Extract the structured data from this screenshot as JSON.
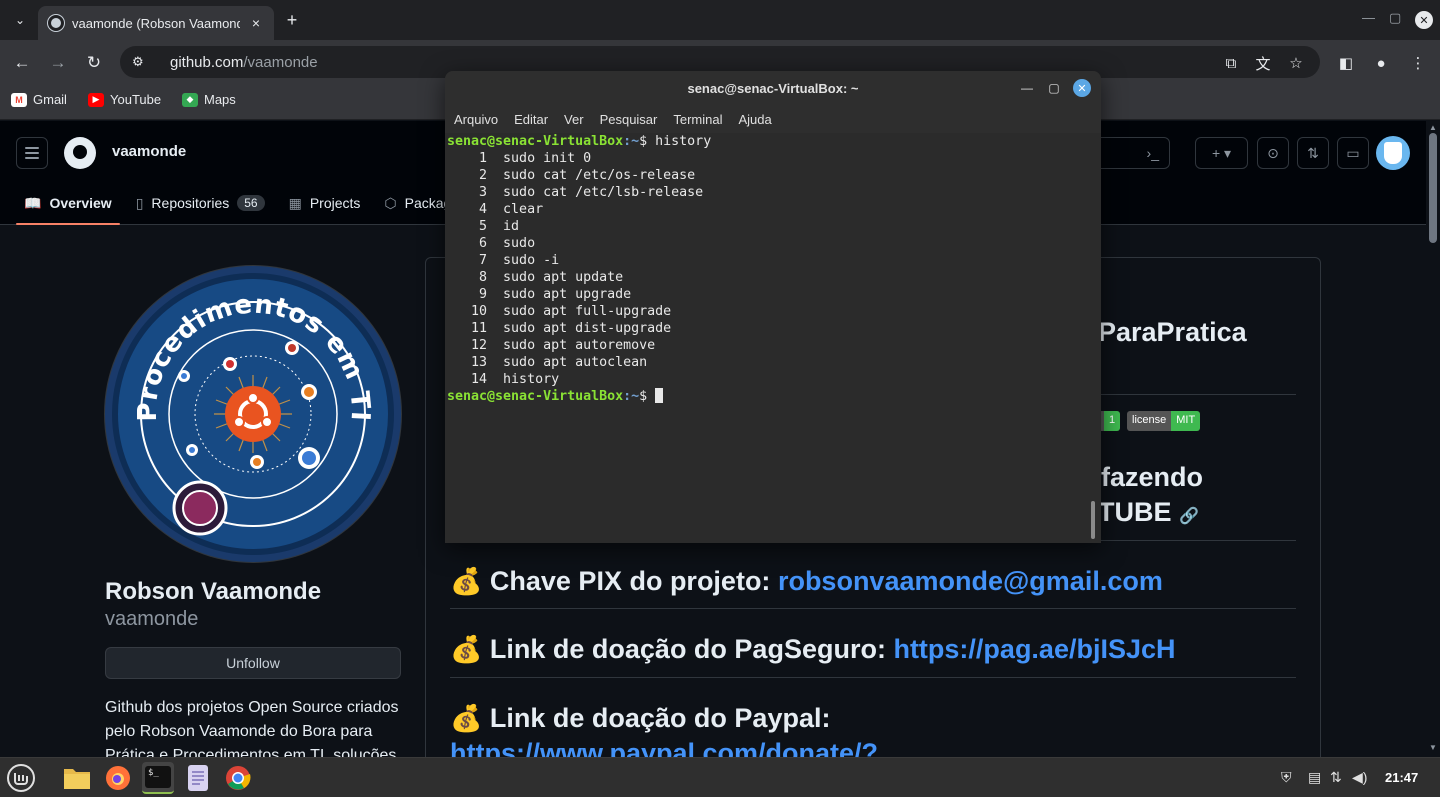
{
  "browser": {
    "tab": {
      "title": "vaamonde (Robson Vaamonde)",
      "close": "×"
    },
    "new_tab": "+",
    "url": {
      "host": "github.com",
      "path": "/vaamonde"
    },
    "bookmarks": [
      {
        "label": "Gmail",
        "icon": "gmail-icon",
        "color": "#ea4335"
      },
      {
        "label": "YouTube",
        "icon": "youtube-icon",
        "color": "#ff0000"
      },
      {
        "label": "Maps",
        "icon": "maps-icon",
        "color": "#34a853"
      }
    ]
  },
  "github": {
    "username": "vaamonde",
    "tabs": [
      {
        "label": "Overview",
        "icon": "book-icon"
      },
      {
        "label": "Repositories",
        "icon": "repo-icon",
        "count": "56"
      },
      {
        "label": "Projects",
        "icon": "table-icon"
      },
      {
        "label": "Packages",
        "icon": "package-icon"
      }
    ],
    "profile": {
      "name": "Robson Vaamonde",
      "login": "vaamonde",
      "follow_button": "Unfollow",
      "bio": "Github dos projetos Open Source criados pelo Robson Vaamonde do Bora para Prática e Procedimentos em TI, soluções"
    },
    "avatar_text": "Procedimentos em TI",
    "readme": {
      "heading1_tail": "ParaPratica",
      "badges": [
        {
          "left": "",
          "right": "1",
          "color": "#3fb950"
        },
        {
          "left": "license",
          "right": "MIT",
          "color": "#3fb950"
        }
      ],
      "heading2_line1": "fazendo",
      "heading2_line2": "TUBE",
      "pix_label": "Chave PIX do projeto: ",
      "pix_link": "robsonvaamonde@gmail.com",
      "pagseguro_label": "Link de doação do PagSeguro: ",
      "pagseguro_link": "https://pag.ae/bjISJcH",
      "paypal_label": "Link de doação do Paypal:",
      "paypal_link": "https://www.paypal.com/donate/?"
    }
  },
  "terminal": {
    "title": "senac@senac-VirtualBox: ~",
    "menu": [
      "Arquivo",
      "Editar",
      "Ver",
      "Pesquisar",
      "Terminal",
      "Ajuda"
    ],
    "prompt_user": "senac@senac-VirtualBox",
    "prompt_path": ":~",
    "prompt_symbol": "$ ",
    "command": "history",
    "history": [
      {
        "n": "1",
        "cmd": "sudo init 0"
      },
      {
        "n": "2",
        "cmd": "sudo cat /etc/os-release"
      },
      {
        "n": "3",
        "cmd": "sudo cat /etc/lsb-release"
      },
      {
        "n": "4",
        "cmd": "clear"
      },
      {
        "n": "5",
        "cmd": "id"
      },
      {
        "n": "6",
        "cmd": "sudo"
      },
      {
        "n": "7",
        "cmd": "sudo -i"
      },
      {
        "n": "8",
        "cmd": "sudo apt update"
      },
      {
        "n": "9",
        "cmd": "sudo apt upgrade"
      },
      {
        "n": "10",
        "cmd": "sudo apt full-upgrade"
      },
      {
        "n": "11",
        "cmd": "sudo apt dist-upgrade"
      },
      {
        "n": "12",
        "cmd": "sudo apt autoremove"
      },
      {
        "n": "13",
        "cmd": "sudo apt autoclean"
      },
      {
        "n": "14",
        "cmd": "history"
      }
    ]
  },
  "taskbar": {
    "clock": "21:47",
    "apps": [
      "mint-menu-icon",
      "files-icon",
      "firefox-icon",
      "terminal-icon",
      "text-editor-icon",
      "chrome-icon"
    ]
  }
}
